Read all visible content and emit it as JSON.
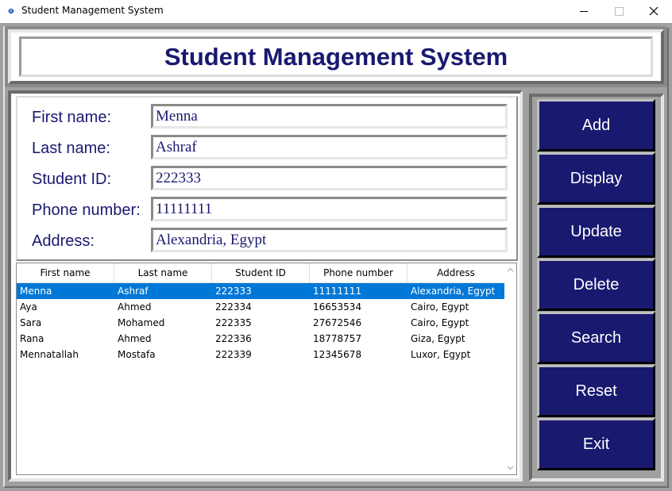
{
  "window": {
    "title": "Student Management System",
    "controls": [
      "minimize",
      "maximize",
      "close"
    ]
  },
  "header": {
    "title": "Student Management System"
  },
  "form": {
    "first_name": {
      "label": "First name:",
      "value": "Menna"
    },
    "last_name": {
      "label": "Last name:",
      "value": "Ashraf"
    },
    "student_id": {
      "label": "Student ID:",
      "value": "222333"
    },
    "phone": {
      "label": "Phone number:",
      "value": "11111111"
    },
    "address": {
      "label": "Address:",
      "value": "Alexandria, Egypt"
    }
  },
  "table": {
    "columns": [
      "First name",
      "Last name",
      "Student ID",
      "Phone number",
      "Address"
    ],
    "rows": [
      [
        "Menna",
        "Ashraf",
        "222333",
        "11111111",
        "Alexandria, Egypt"
      ],
      [
        "Aya",
        "Ahmed",
        "222334",
        "16653534",
        "Cairo, Egypt"
      ],
      [
        "Sara",
        "Mohamed",
        "222335",
        "27672546",
        "Cairo, Egypt"
      ],
      [
        "Rana",
        "Ahmed",
        "222336",
        "18778757",
        "Giza, Egypt"
      ],
      [
        "Mennatallah",
        "Mostafa",
        "222339",
        "12345678",
        "Luxor, Egypt"
      ]
    ],
    "selected_row": 0
  },
  "buttons": {
    "add": "Add",
    "display": "Display",
    "update": "Update",
    "delete": "Delete",
    "search": "Search",
    "reset": "Reset",
    "exit": "Exit"
  },
  "colors": {
    "accent": "#191970",
    "selection": "#0078d7",
    "frame": "#a0a0a0"
  },
  "icons": {
    "app": "feather-icon",
    "scroll_up": "chevron-up-icon",
    "scroll_down": "chevron-down-icon"
  }
}
